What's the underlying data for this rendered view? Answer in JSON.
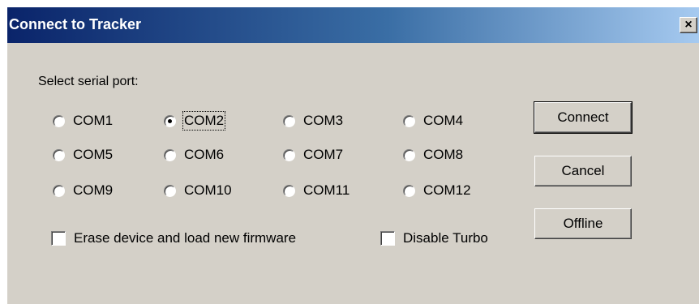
{
  "window": {
    "title": "Connect to Tracker",
    "close_glyph": "×"
  },
  "prompt": "Select serial port:",
  "ports": [
    {
      "label": "COM1",
      "checked": false
    },
    {
      "label": "COM2",
      "checked": true
    },
    {
      "label": "COM3",
      "checked": false
    },
    {
      "label": "COM4",
      "checked": false
    },
    {
      "label": "COM5",
      "checked": false
    },
    {
      "label": "COM6",
      "checked": false
    },
    {
      "label": "COM7",
      "checked": false
    },
    {
      "label": "COM8",
      "checked": false
    },
    {
      "label": "COM9",
      "checked": false
    },
    {
      "label": "COM10",
      "checked": false
    },
    {
      "label": "COM11",
      "checked": false
    },
    {
      "label": "COM12",
      "checked": false
    }
  ],
  "options": {
    "erase_label": "Erase device and load new firmware",
    "erase_checked": false,
    "turbo_label": "Disable Turbo",
    "turbo_checked": false
  },
  "buttons": {
    "connect": "Connect",
    "cancel": "Cancel",
    "offline": "Offline"
  },
  "colors": {
    "dialog_bg": "#d4d0c8",
    "title_gradient_start": "#0a246a",
    "title_gradient_end": "#a6caf0",
    "title_text": "#ffffff"
  }
}
